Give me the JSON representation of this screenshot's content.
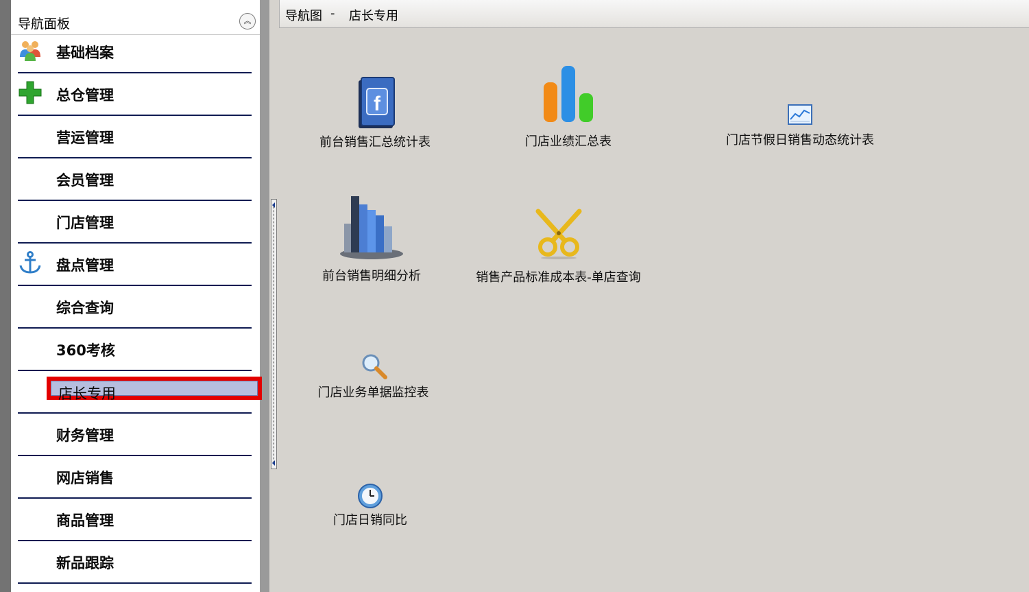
{
  "nav": {
    "title": "导航面板",
    "collapse_icon": "double-chevron-up-icon",
    "items": [
      {
        "label": "基础档案",
        "icon": "users-icon"
      },
      {
        "label": "总仓管理",
        "icon": "green-plus-icon"
      },
      {
        "label": "营运管理"
      },
      {
        "label": "会员管理"
      },
      {
        "label": "门店管理"
      },
      {
        "label": "盘点管理",
        "icon": "anchor-icon"
      },
      {
        "label": "综合查询"
      },
      {
        "label": "360考核"
      },
      {
        "label": "店长专用",
        "selected": true
      },
      {
        "label": "财务管理"
      },
      {
        "label": "网店销售"
      },
      {
        "label": "商品管理"
      },
      {
        "label": "新品跟踪"
      }
    ]
  },
  "breadcrumb": {
    "prefix": "导航图",
    "separator": "-",
    "current": "店长专用"
  },
  "tiles": [
    {
      "label": "前台销售汇总统计表",
      "icon": "blue-book-icon"
    },
    {
      "label": "门店业绩汇总表",
      "icon": "bar-chart-icon"
    },
    {
      "label": "门店节假日销售动态统计表",
      "icon": "line-chart-icon"
    },
    {
      "label": "前台销售明细分析",
      "icon": "3d-bars-icon"
    },
    {
      "label": "销售产品标准成本表-单店查询",
      "icon": "scissors-icon"
    },
    {
      "label": "门店业务单据监控表",
      "icon": "magnifier-icon"
    },
    {
      "label": "门店日销同比",
      "icon": "clock-icon"
    }
  ],
  "colors": {
    "selection_border": "#e30000",
    "selection_fill": "#b6bedf",
    "divider": "#0f1b52",
    "workspace_bg": "#d6d3ce"
  }
}
